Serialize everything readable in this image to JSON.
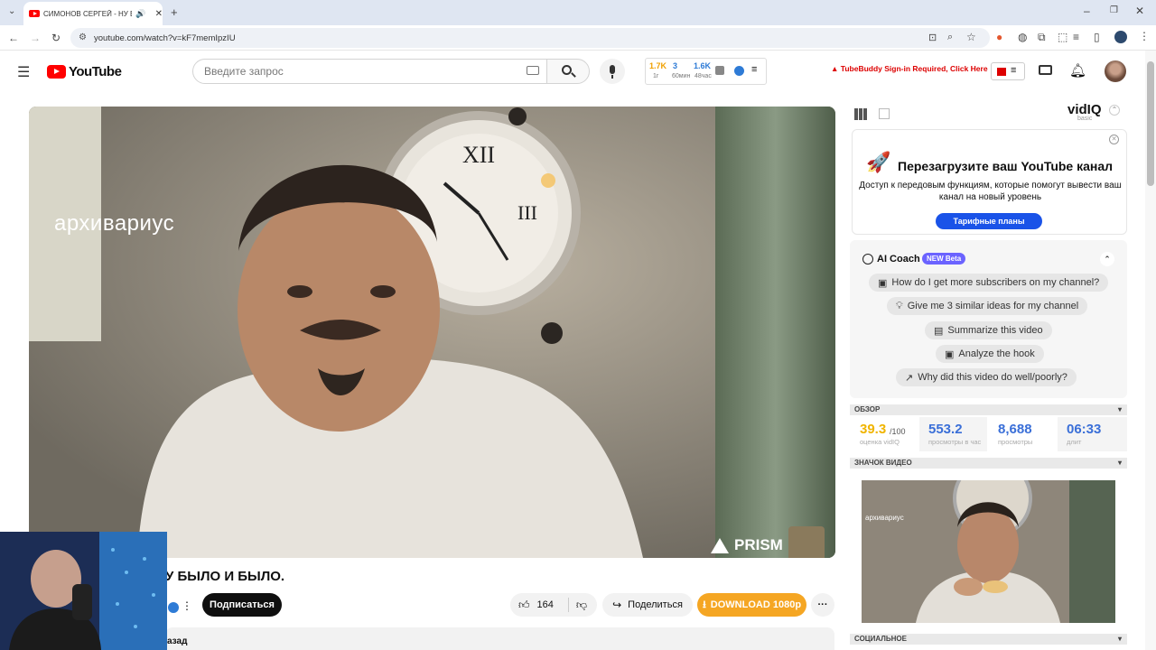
{
  "browser": {
    "tab_title": "СИМОНОВ СЕРГЕЙ - НУ БЫ",
    "url": "youtube.com/watch?v=kF7memIpzIU"
  },
  "youtube": {
    "logo_text": "YouTube",
    "search_placeholder": "Введите запрос",
    "stats": {
      "a_val": "1.7K",
      "a_lbl": "1г",
      "b_val": "3",
      "b_lbl": "60мин",
      "c_val": "1.6K",
      "c_lbl": "48час"
    },
    "tubebuddy": "TubeBuddy Sign-in Required, Click Here"
  },
  "video": {
    "watermark": "архивариус",
    "prism": "PRISM",
    "title": "У БЫЛО И БЫЛО.",
    "subscribe": "Подписаться",
    "likes": "164",
    "share": "Поделиться",
    "download": "DOWNLOAD 1080p",
    "desc_fragment": "азад"
  },
  "vidiq": {
    "logo": "vidIQ",
    "logo_sub": "basic",
    "promo_title": "Перезагрузите ваш YouTube канал",
    "promo_text": "Доступ к передовым функциям, которые помогут вывести ваш канал на новый уровень",
    "promo_button": "Тарифные планы",
    "coach_title": "AI Coach",
    "coach_badge": "NEW Beta",
    "chips": [
      "How do I get more subscribers on my channel?",
      "Give me 3 similar ideas for my channel",
      "Summarize this video",
      "Analyze the hook",
      "Why did this video do well/poorly?"
    ],
    "overview_label": "ОБЗОР",
    "score": "39.3",
    "score_max": "/100",
    "score_lbl": "оценка vidIQ",
    "vph": "553.2",
    "vph_lbl": "просмотры в час",
    "views": "8,688",
    "views_lbl": "просмотры",
    "length": "06:33",
    "length_lbl": "длит",
    "thumb_label": "ЗНАЧОК ВИДЕО",
    "thumb_watermark": "архивариус",
    "social_label": "СОЦИАЛЬНОЕ"
  },
  "colors": {
    "yt_red": "#ff0000",
    "vidiq_blue": "#1a53e8",
    "download_orange": "#f5a623",
    "score_yellow": "#f0b400",
    "stat_blue": "#3a6fd8"
  }
}
